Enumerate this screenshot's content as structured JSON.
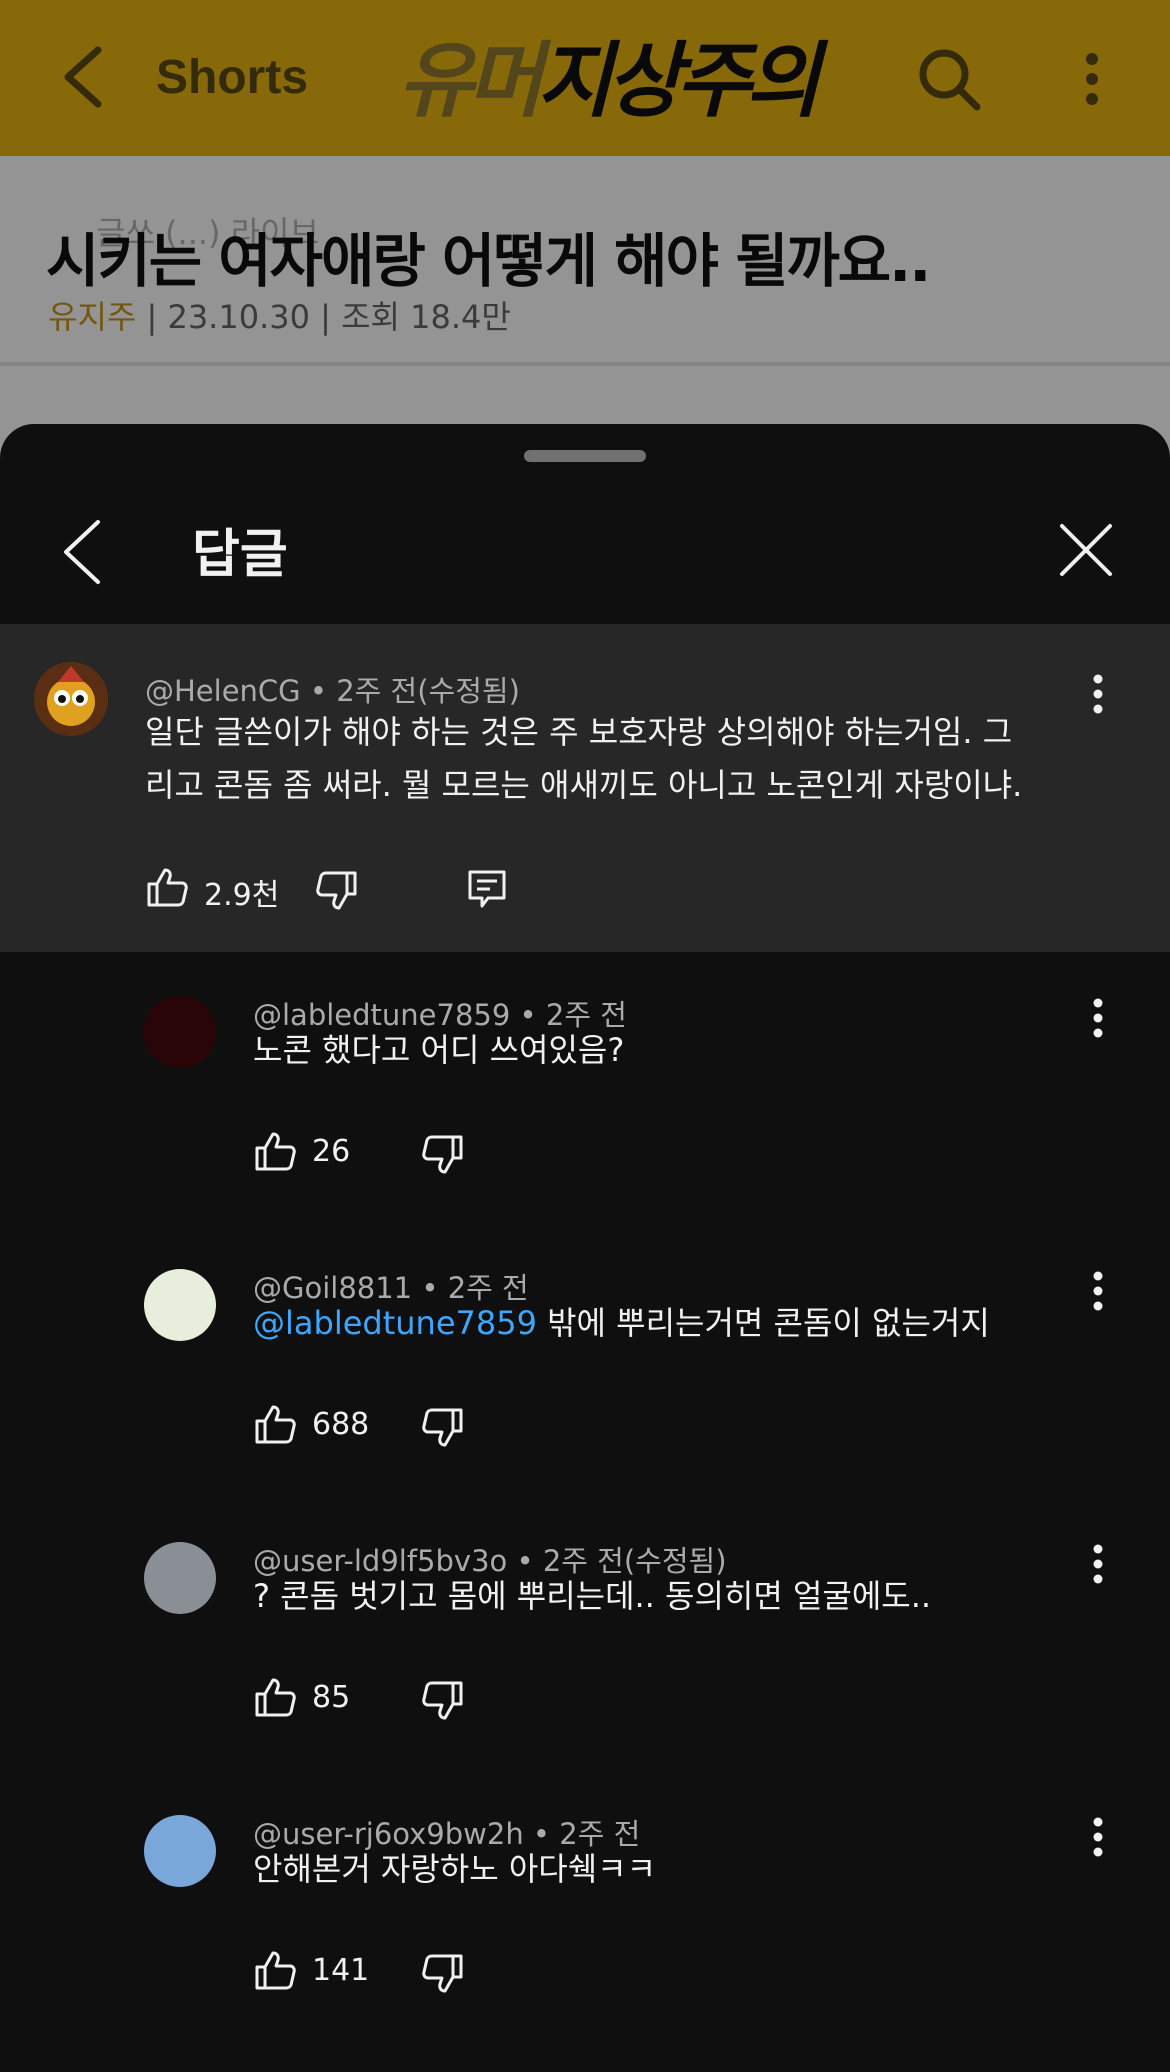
{
  "header": {
    "shorts_label": "Shorts",
    "logo_part_a": "유머",
    "logo_part_b": "지상주의"
  },
  "article": {
    "title": "시키는 여자애랑 어떻게 해야 될까요..",
    "author": "유지주",
    "meta": " | 23.10.30 | 조회 18.4만",
    "ghost_text": "글쓰    (...) 라이브"
  },
  "sheet": {
    "title": "답글"
  },
  "parent_comment": {
    "username": "@HelenCG",
    "time": "2주 전(수정됨)",
    "text_line1": "일단 글쓴이가 해야 하는 것은 주 보호자랑 상의해야 하는거임. 그",
    "text_line2": "리고 콘돔 좀 써라. 뭘 모르는 애새끼도 아니고 노콘인게 자랑이냐.",
    "likes": "2.9천"
  },
  "replies": [
    {
      "username": "@labledtune7859",
      "time": "2주 전",
      "mention": "",
      "text": "노콘 했다고 어디 쓰여있음?",
      "likes": "26",
      "avatar_color": "#2a0508"
    },
    {
      "username": "@Goil8811",
      "time": "2주 전",
      "mention": "@labledtune7859",
      "text": " 밖에 뿌리는거면 콘돔이 없는거지",
      "likes": "688",
      "avatar_color": "#e8eedc"
    },
    {
      "username": "@user-ld9lf5bv3o",
      "time": "2주 전(수정됨)",
      "mention": "",
      "text": "? 콘돔 벗기고 몸에 뿌리는데.. 동의히면 얼굴에도..",
      "likes": "85",
      "avatar_color": "#8a8f96"
    },
    {
      "username": "@user-rj6ox9bw2h",
      "time": "2주 전",
      "mention": "",
      "text": "안해본거 자랑하노 아다쉑ㅋㅋ",
      "likes": "141",
      "avatar_color": "#7aa7d9"
    }
  ],
  "colors": {
    "brand_yellow": "#e8b511",
    "mention_blue": "#3ea6ff",
    "sheet_bg": "#0f0f0f",
    "highlight_bg": "#272727"
  }
}
